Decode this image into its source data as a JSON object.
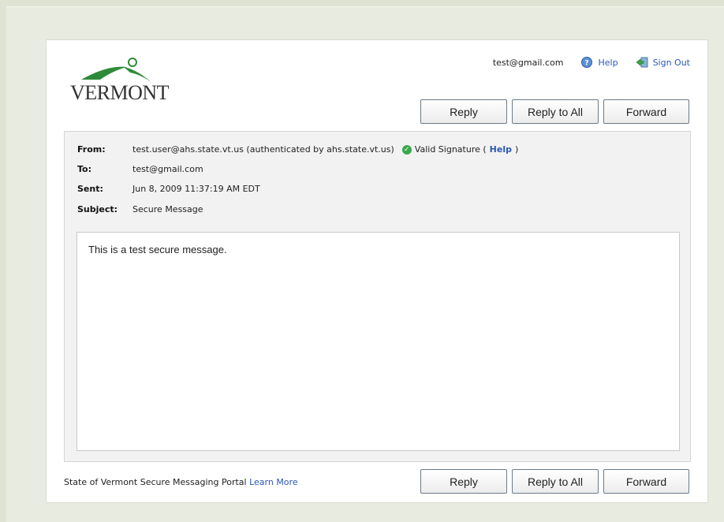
{
  "brand": {
    "name": "VERMONT"
  },
  "user_bar": {
    "email": "test@gmail.com",
    "help_label": "Help",
    "signout_label": "Sign Out"
  },
  "actions": {
    "reply": "Reply",
    "reply_all": "Reply to All",
    "forward": "Forward"
  },
  "message": {
    "from_label": "From:",
    "from_value": "test.user@ahs.state.vt.us (authenticated by ahs.state.vt.us)",
    "signature_status": "Valid Signature (",
    "signature_help": "Help",
    "signature_close": ")",
    "to_label": "To:",
    "to_value": "test@gmail.com",
    "sent_label": "Sent:",
    "sent_value": "Jun 8, 2009 11:37:19 AM EDT",
    "subject_label": "Subject:",
    "subject_value": "Secure Message",
    "body": "This is a test secure message."
  },
  "footer": {
    "text": "State of Vermont Secure Messaging Portal",
    "link": "Learn More"
  },
  "colors": {
    "background": "#dee4d4",
    "link": "#2b57b8",
    "valid_check": "#3aa84a",
    "logo_green": "#2e8b3a"
  },
  "icons": {
    "help": "help-icon",
    "signout": "sign-out-icon",
    "valid": "check-circle-icon"
  }
}
